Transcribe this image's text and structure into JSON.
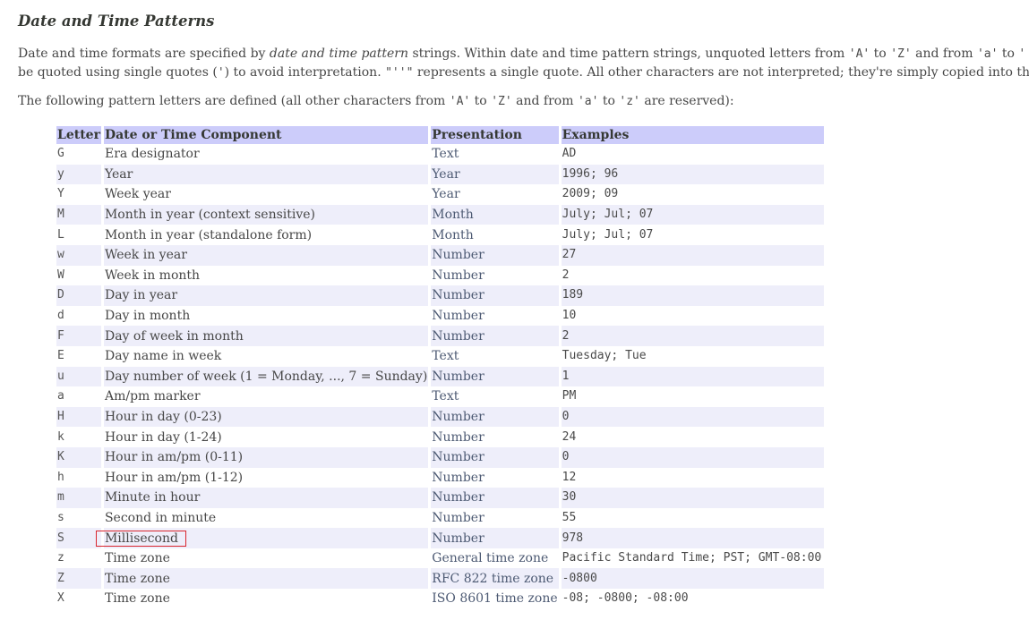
{
  "section": {
    "title": "Date and Time Patterns"
  },
  "intro": {
    "p1_a": "Date and time formats are specified by ",
    "p1_em": "date and time pattern",
    "p1_b": " strings. Within date and time pattern strings, unquoted letters from ",
    "p1_code1": "'A'",
    "p1_c": " to ",
    "p1_code2": "'Z'",
    "p1_d": " and from ",
    "p1_code3": "'a'",
    "p1_e": " to ",
    "p1_code4": "'",
    "p2_a": "be quoted using single quotes (",
    "p2_code1": "'",
    "p2_b": ") to avoid interpretation. ",
    "p2_code2": "\"''\"",
    "p2_c": " represents a single quote. All other characters are not interpreted; they're simply copied into th",
    "p3_a": "The following pattern letters are defined (all other characters from ",
    "p3_code1": "'A'",
    "p3_b": " to ",
    "p3_code2": "'Z'",
    "p3_c": " and from ",
    "p3_code3": "'a'",
    "p3_d": " to ",
    "p3_code4": "'z'",
    "p3_e": " are reserved):"
  },
  "table": {
    "headers": [
      "Letter",
      "Date or Time Component",
      "Presentation",
      "Examples"
    ],
    "rows": [
      {
        "letter": "G",
        "component": "Era designator",
        "presentation": "Text",
        "example": "AD"
      },
      {
        "letter": "y",
        "component": "Year",
        "presentation": "Year",
        "example": "1996; 96"
      },
      {
        "letter": "Y",
        "component": "Week year",
        "presentation": "Year",
        "example": "2009; 09"
      },
      {
        "letter": "M",
        "component": "Month in year (context sensitive)",
        "presentation": "Month",
        "example": "July; Jul; 07"
      },
      {
        "letter": "L",
        "component": "Month in year (standalone form)",
        "presentation": "Month",
        "example": "July; Jul; 07"
      },
      {
        "letter": "w",
        "component": "Week in year",
        "presentation": "Number",
        "example": "27"
      },
      {
        "letter": "W",
        "component": "Week in month",
        "presentation": "Number",
        "example": "2"
      },
      {
        "letter": "D",
        "component": "Day in year",
        "presentation": "Number",
        "example": "189"
      },
      {
        "letter": "d",
        "component": "Day in month",
        "presentation": "Number",
        "example": "10"
      },
      {
        "letter": "F",
        "component": "Day of week in month",
        "presentation": "Number",
        "example": "2"
      },
      {
        "letter": "E",
        "component": "Day name in week",
        "presentation": "Text",
        "example": "Tuesday; Tue"
      },
      {
        "letter": "u",
        "component": "Day number of week (1 = Monday, ..., 7 = Sunday)",
        "presentation": "Number",
        "example": "1"
      },
      {
        "letter": "a",
        "component": "Am/pm marker",
        "presentation": "Text",
        "example": "PM"
      },
      {
        "letter": "H",
        "component": "Hour in day (0-23)",
        "presentation": "Number",
        "example": "0"
      },
      {
        "letter": "k",
        "component": "Hour in day (1-24)",
        "presentation": "Number",
        "example": "24"
      },
      {
        "letter": "K",
        "component": "Hour in am/pm (0-11)",
        "presentation": "Number",
        "example": "0"
      },
      {
        "letter": "h",
        "component": "Hour in am/pm (1-12)",
        "presentation": "Number",
        "example": "12"
      },
      {
        "letter": "m",
        "component": "Minute in hour",
        "presentation": "Number",
        "example": "30"
      },
      {
        "letter": "s",
        "component": "Second in minute",
        "presentation": "Number",
        "example": "55"
      },
      {
        "letter": "S",
        "component": "Millisecond",
        "presentation": "Number",
        "example": "978",
        "highlighted": true
      },
      {
        "letter": "z",
        "component": "Time zone",
        "presentation": "General time zone",
        "example": "Pacific Standard Time; PST; GMT-08:00"
      },
      {
        "letter": "Z",
        "component": "Time zone",
        "presentation": "RFC 822 time zone",
        "example": "-0800"
      },
      {
        "letter": "X",
        "component": "Time zone",
        "presentation": "ISO 8601 time zone",
        "example": "-08; -0800; -08:00"
      }
    ]
  },
  "colors": {
    "header_bg": "#ccccfa",
    "alt_row_bg": "#eeeefa",
    "highlight_border": "#d9262e"
  }
}
